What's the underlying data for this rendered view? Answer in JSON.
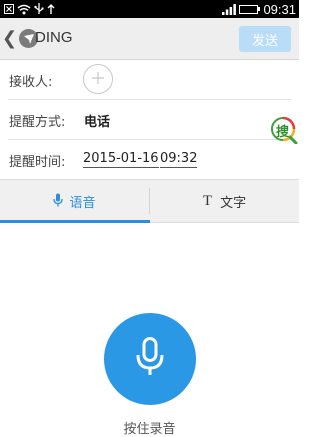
{
  "status_bar": {
    "time": "09:31",
    "battery_level": 1.0,
    "icons": [
      "close-box-icon",
      "wifi-icon",
      "usb-icon",
      "data-up-icon",
      "signal-icon",
      "battery-icon"
    ]
  },
  "navbar": {
    "title": "DING",
    "send_label": "发送",
    "send_color": "#b9dcf7"
  },
  "form": {
    "recipient_label": "接收人:",
    "method_label": "提醒方式:",
    "method_value": "电话",
    "time_label": "提醒时间:",
    "date_value": "2015-01-16",
    "time_value": "09:32"
  },
  "tabs": {
    "voice_label": "语音",
    "text_label": "文字",
    "text_icon_glyph": "T",
    "active": "voice",
    "accent_color": "#2a8fe0"
  },
  "record": {
    "label": "按住录音",
    "button_color": "#2b98e6"
  },
  "floating": {
    "search_glyph": "搜"
  }
}
